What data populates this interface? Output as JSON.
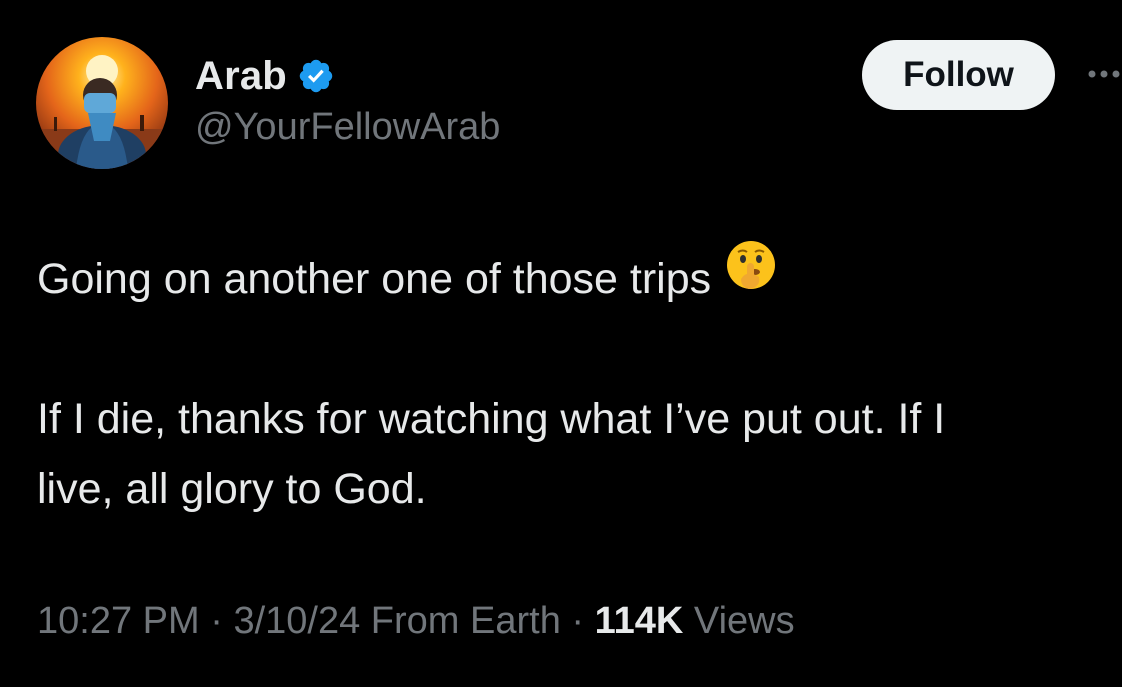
{
  "tweet": {
    "author": {
      "display_name": "Arab",
      "handle": "@YourFellowArab",
      "verified_badge_color": "#1d9bf0",
      "avatar_icon": "profile-photo-desert-person"
    },
    "follow_label": "Follow",
    "more_icon": "more-horizontal-icon",
    "text": {
      "line1": "Going on another one of those trips",
      "emoji": "shushing-face",
      "line2": "If I die, thanks for watching what I’ve put out. If I",
      "line3": "live, all glory to God."
    },
    "meta": {
      "time": "10:27 PM",
      "separator1": " · ",
      "date": "3/10/24",
      "location": " From Earth",
      "separator2": " · ",
      "views_count": "114K",
      "views_label": " Views"
    }
  },
  "colors": {
    "background": "#000000",
    "primary_text": "#e7e9ea",
    "secondary_text": "#71767b",
    "button_bg": "#eff3f4",
    "button_text": "#0f1419",
    "verified": "#1d9bf0"
  }
}
